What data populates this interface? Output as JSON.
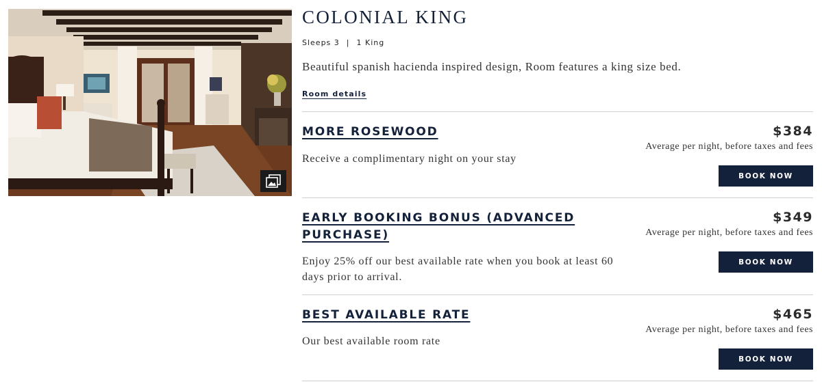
{
  "room": {
    "title": "COLONIAL KING",
    "sleeps": "Sleeps 3",
    "separator": "|",
    "beds": "1 King",
    "description": "Beautiful spanish hacienda inspired design, Room features a king size bed.",
    "details_link": "Room details",
    "image_alt": "Colonial King room with king bed, dark wood beams and french doors",
    "gallery_icon": "gallery-icon"
  },
  "rates": [
    {
      "name": "MORE ROSEWOOD",
      "description": "Receive a complimentary night on your stay",
      "price": "$384",
      "note": "Average per night, before taxes and fees",
      "button": "BOOK NOW"
    },
    {
      "name": "EARLY BOOKING BONUS (ADVANCED PURCHASE)",
      "description": "Enjoy 25% off our best available rate when you book at least 60 days prior to arrival.",
      "price": "$349",
      "note": "Average per night, before taxes and fees",
      "button": "BOOK NOW"
    },
    {
      "name": "BEST AVAILABLE RATE",
      "description": "Our best available room rate",
      "price": "$465",
      "note": "Average per night, before taxes and fees",
      "button": "BOOK NOW"
    }
  ],
  "colors": {
    "navy": "#14213a",
    "divider": "#cfcfcf"
  }
}
